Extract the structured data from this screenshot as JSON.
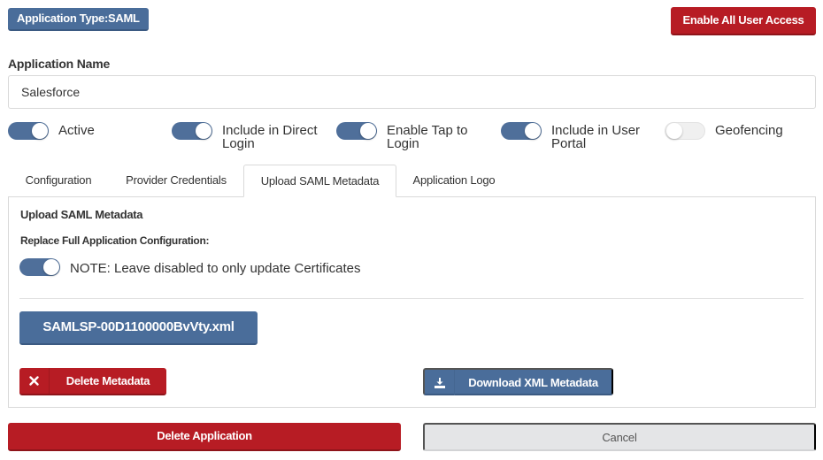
{
  "header": {
    "app_type_badge": "Application Type:SAML",
    "enable_all_label": "Enable All User Access"
  },
  "app_name": {
    "label": "Application Name",
    "value": "Salesforce"
  },
  "toggles": [
    {
      "label_line1": "Active",
      "label_line2": "",
      "on": true
    },
    {
      "label_line1": "Include in Direct",
      "label_line2": "Login",
      "on": true
    },
    {
      "label_line1": "Enable Tap to",
      "label_line2": "Login",
      "on": true
    },
    {
      "label_line1": "Include in User",
      "label_line2": "Portal",
      "on": true
    },
    {
      "label_line1": "Geofencing",
      "label_line2": "",
      "on": false
    }
  ],
  "tabs": [
    {
      "label": "Configuration",
      "active": false
    },
    {
      "label": "Provider Credentials",
      "active": false
    },
    {
      "label": "Upload SAML Metadata",
      "active": true
    },
    {
      "label": "Application Logo",
      "active": false
    }
  ],
  "panel": {
    "title": "Upload SAML Metadata",
    "replace_label": "Replace Full Application Configuration:",
    "replace_toggle_on": true,
    "note": "NOTE: Leave disabled to only update Certificates",
    "file_name": "SAMLSP-00D1100000BvVty.xml",
    "delete_metadata_label": "Delete Metadata",
    "download_metadata_label": "Download XML Metadata"
  },
  "footer": {
    "delete_app_label": "Delete Application",
    "cancel_label": "Cancel"
  },
  "colors": {
    "primary_blue": "#4a6d9a",
    "danger_red": "#b71c24",
    "neutral_gray": "#e4e5e7"
  },
  "icons": {
    "delete_icon": "close-icon",
    "download_icon": "download-icon"
  }
}
